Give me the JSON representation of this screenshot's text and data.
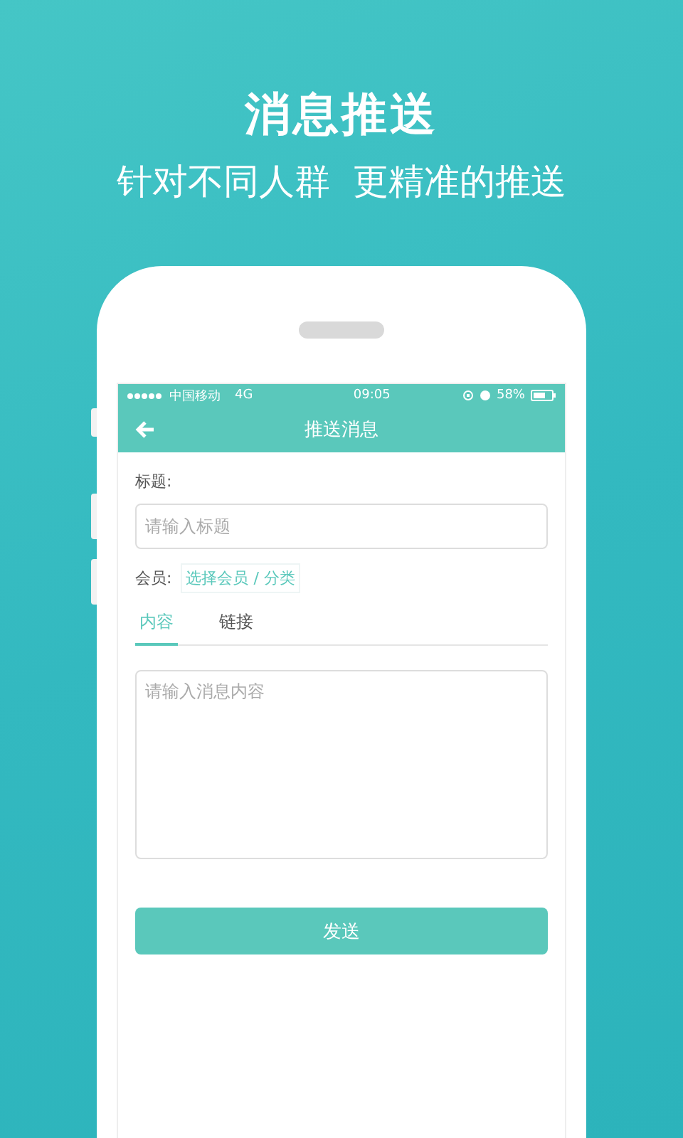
{
  "headline": "消息推送",
  "subheadline": "针对不同人群  更精准的推送",
  "status_bar": {
    "carrier": "中国移动",
    "network": "4G",
    "time": "09:05",
    "battery": "58%"
  },
  "nav_bar": {
    "title": "推送消息"
  },
  "form": {
    "title_label": "标题:",
    "title_placeholder": "请输入标题",
    "member_label": "会员:",
    "member_link": "选择会员 / 分类",
    "tabs": [
      {
        "label": "内容",
        "selected": true
      },
      {
        "label": "链接",
        "selected": false
      }
    ],
    "content_placeholder": "请输入消息内容",
    "submit": "发送"
  }
}
